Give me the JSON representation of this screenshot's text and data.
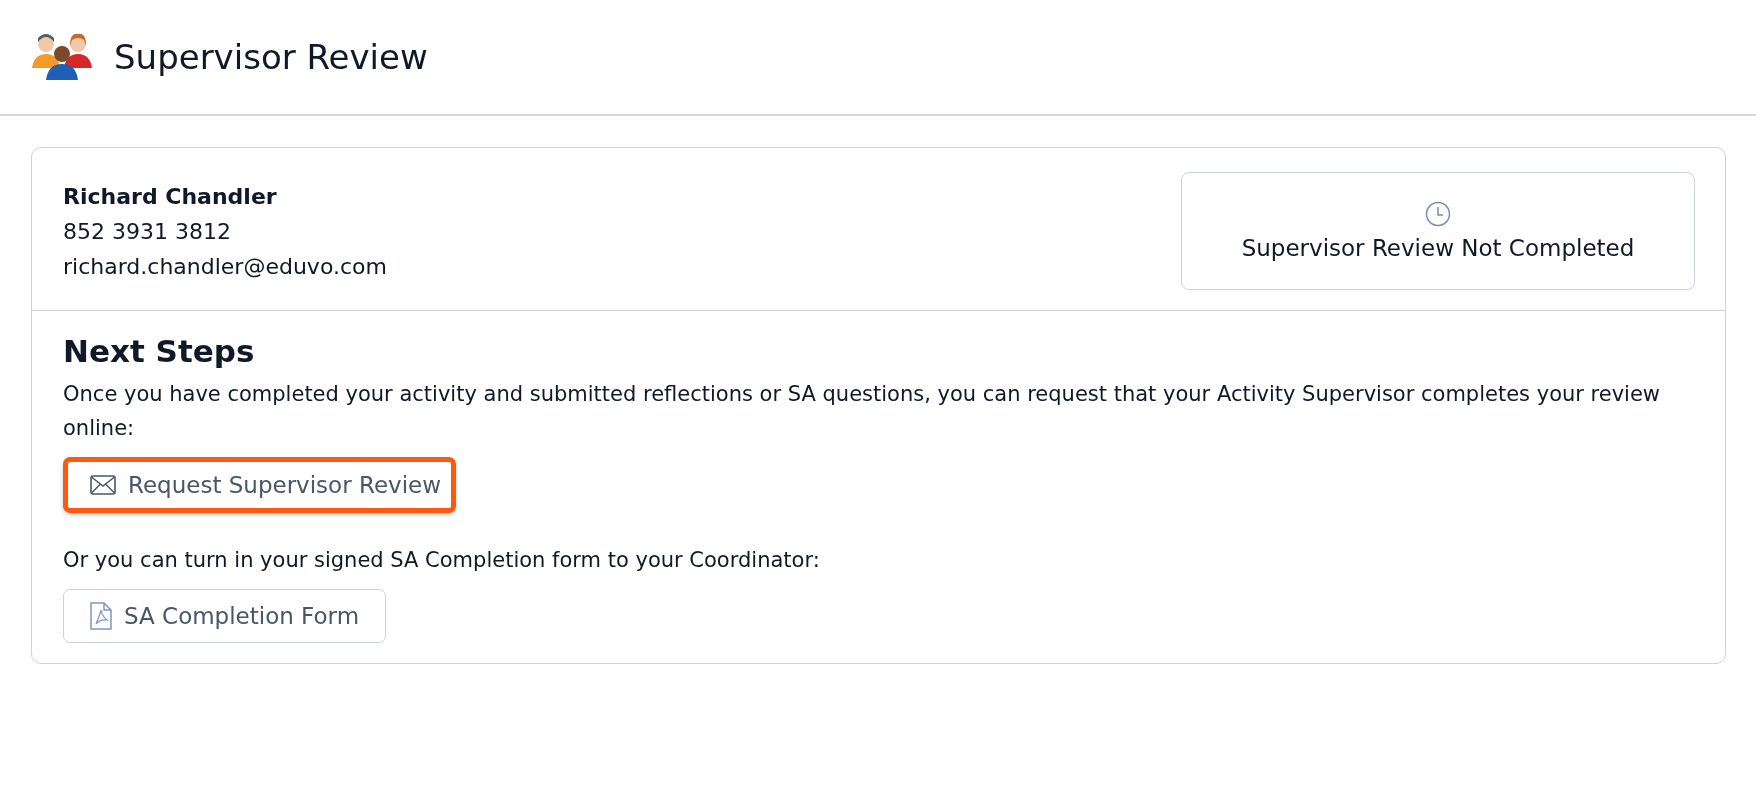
{
  "page": {
    "title": "Supervisor Review"
  },
  "contact": {
    "name": "Richard Chandler",
    "phone": "852 3931 3812",
    "email": "richard.chandler@eduvo.com"
  },
  "status": {
    "text": "Supervisor Review Not Completed"
  },
  "next_steps": {
    "heading": "Next Steps",
    "paragraphs": [
      {
        "text": "Once you have completed your activity and submitted reflections or SA questions, you can request that your Activity Supervisor completes your review online:",
        "button": {
          "kind": "email",
          "label": "Request Supervisor Review",
          "highlighted": true
        }
      },
      {
        "text": "Or you can turn in your signed SA Completion form to your Coordinator:",
        "button": {
          "kind": "pdf",
          "label": "SA Completion Form",
          "highlighted": false
        }
      }
    ]
  }
}
